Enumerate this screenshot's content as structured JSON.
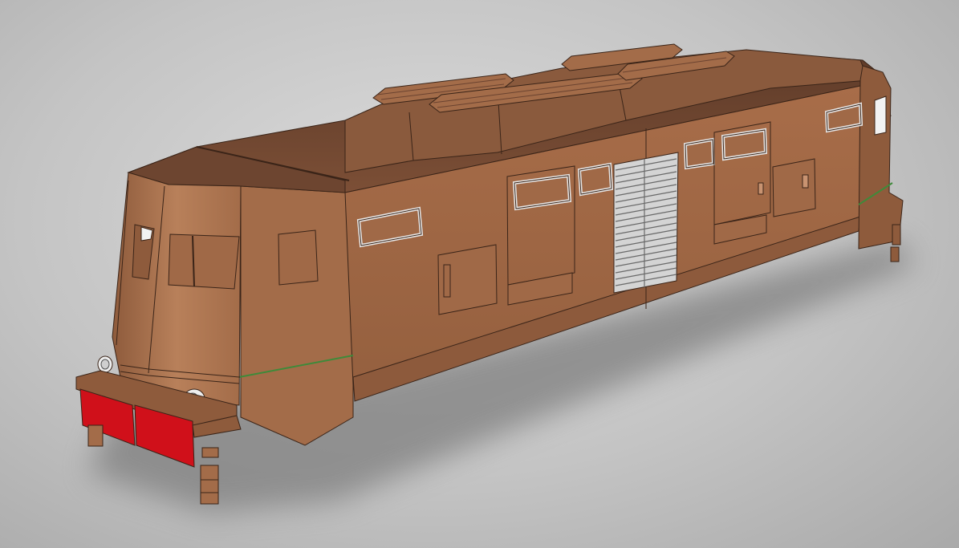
{
  "scene": {
    "subject": "locomotive-body-3d-model",
    "render_style": "shaded-with-edges",
    "colors": {
      "background": "#c8c8c8",
      "body_light": "#b57a55",
      "body_mid": "#9c6544",
      "body_dark": "#7a4a31",
      "roof": "#6d4530",
      "buffer_beam": "#d0101a",
      "window_frame": "#e8e8e8",
      "grille": "#d4d4d4",
      "edge_lines": "#3a2418",
      "shadow": "#7c7c7c",
      "accent_line": "#3f8a3a"
    },
    "features": [
      "cab-front",
      "side-windows",
      "side-doors",
      "ventilation-grille",
      "roof-vents",
      "headlamps",
      "red-buffer-beam",
      "steps"
    ]
  }
}
